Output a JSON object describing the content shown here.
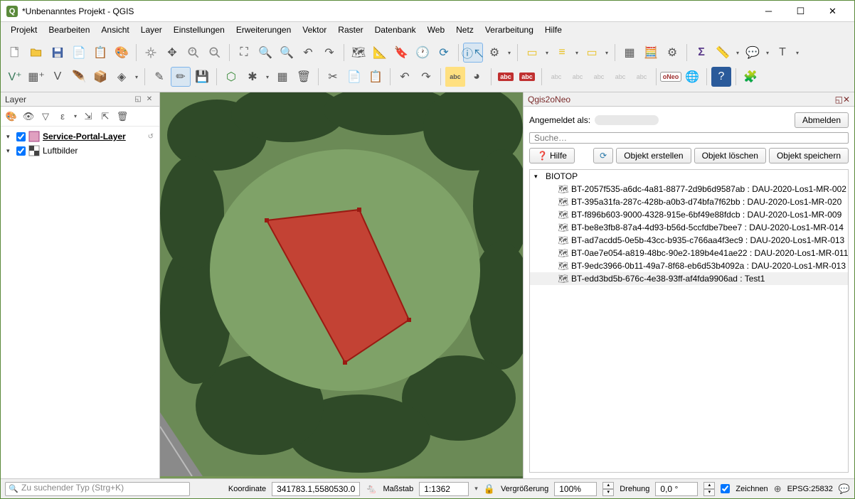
{
  "window": {
    "title": "*Unbenanntes Projekt - QGIS"
  },
  "menu": [
    "Projekt",
    "Bearbeiten",
    "Ansicht",
    "Layer",
    "Einstellungen",
    "Erweiterungen",
    "Vektor",
    "Raster",
    "Datenbank",
    "Web",
    "Netz",
    "Verarbeitung",
    "Hilfe"
  ],
  "layers_panel": {
    "title": "Layer",
    "items": [
      {
        "name": "Service-Portal-Layer",
        "checked": true,
        "bold": true
      },
      {
        "name": "Luftbilder",
        "checked": true,
        "bold": false
      }
    ]
  },
  "right_panel": {
    "title": "Qgis2oNeo",
    "logged_in_label": "Angemeldet als:",
    "logout": "Abmelden",
    "search_placeholder": "Suche…",
    "help": "Hilfe",
    "create": "Objekt erstellen",
    "delete": "Objekt löschen",
    "save": "Objekt speichern",
    "tree_root": "BIOTOP",
    "tree_items": [
      "BT-2057f535-a6dc-4a81-8877-2d9b6d9587ab : DAU-2020-Los1-MR-002",
      "BT-395a31fa-287c-428b-a0b3-d74bfa7f62bb : DAU-2020-Los1-MR-020",
      "BT-f896b603-9000-4328-915e-6bf49e88fdcb : DAU-2020-Los1-MR-009",
      "BT-be8e3fb8-87a4-4d93-b56d-5ccfdbe7bee7 : DAU-2020-Los1-MR-014",
      "BT-ad7acdd5-0e5b-43cc-b935-c766aa4f3ec9 : DAU-2020-Los1-MR-013",
      "BT-0ae7e054-a819-48bc-90e2-189b4e41ae22 : DAU-2020-Los1-MR-011",
      "BT-9edc3966-0b11-49a7-8f68-eb6d53b4092a : DAU-2020-Los1-MR-013",
      "BT-edd3bd5b-676c-4e38-93ff-af4fda9906ad : Test1"
    ],
    "selected_index": 7
  },
  "status": {
    "search_placeholder": "Zu suchender Typ (Strg+K)",
    "coord_label": "Koordinate",
    "coord_value": "341783.1,5580530.0",
    "scale_label": "Maßstab",
    "scale_value": "1:1362",
    "mag_label": "Vergrößerung",
    "mag_value": "100%",
    "rot_label": "Drehung",
    "rot_value": "0,0 °",
    "render_label": "Zeichnen",
    "crs_label": "EPSG:25832"
  }
}
